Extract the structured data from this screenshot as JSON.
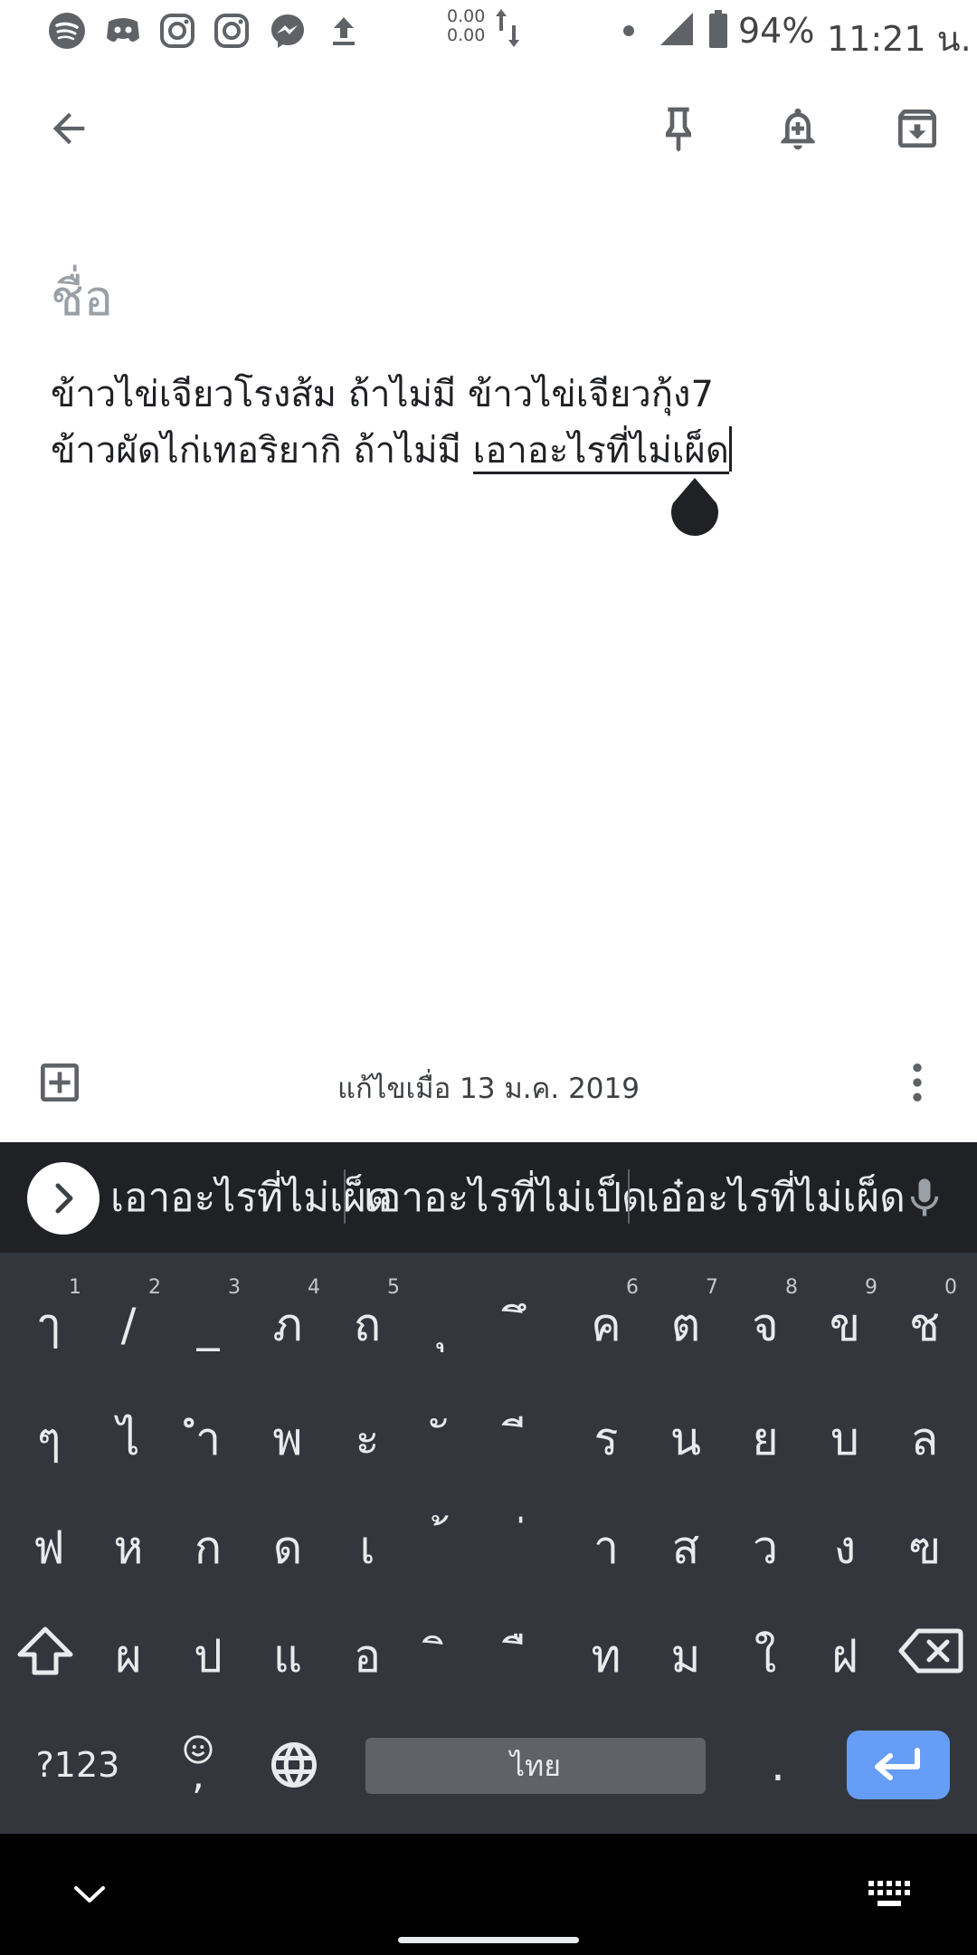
{
  "status_bar": {
    "apps": [
      "spotify-icon",
      "discord-icon",
      "instagram-icon",
      "instagram-icon",
      "messenger-icon",
      "upload-icon"
    ],
    "net_up": "0.00",
    "net_down": "0.00",
    "battery": "94%",
    "time": "11:21 น."
  },
  "toolbar": {
    "back_icon": "arrow-back-icon",
    "pin_icon": "pin-icon",
    "reminder_icon": "bell-plus-icon",
    "archive_icon": "archive-icon"
  },
  "note": {
    "title_placeholder": "ชื่อ",
    "line1": "ข้าวไข่เจียวโรงส้ม ถ้าไม่มี ข้าวไข่เจียวกุ้ง7",
    "line2_prefix": "ข้าวผัดไก่เทอริยากิ ถ้าไม่มี ",
    "line2_composing": "เอาอะไรที่ไม่เผ็ด"
  },
  "bottom_bar": {
    "edited": "แก้ไขเมื่อ 13 ม.ค. 2019"
  },
  "keyboard": {
    "suggestions": [
      "เอาอะไรที่ไม่เผ็ด",
      "เอาอะไรที่ไม่เป็ด",
      "เอ๋อะไรที่ไม่เผ็ด"
    ],
    "rows": [
      [
        {
          "k": "ๅ",
          "h": "1"
        },
        {
          "k": "/",
          "h": "2"
        },
        {
          "k": "_",
          "h": "3"
        },
        {
          "k": "ภ",
          "h": "4"
        },
        {
          "k": "ถ",
          "h": "5"
        },
        {
          "k": "ุ",
          "h": ""
        },
        {
          "k": "ึ",
          "h": ""
        },
        {
          "k": "ค",
          "h": "6"
        },
        {
          "k": "ต",
          "h": "7"
        },
        {
          "k": "จ",
          "h": "8"
        },
        {
          "k": "ข",
          "h": "9"
        },
        {
          "k": "ช",
          "h": "0"
        }
      ],
      [
        {
          "k": "ๆ",
          "h": ""
        },
        {
          "k": "ไ",
          "h": ""
        },
        {
          "k": "ำ",
          "h": ""
        },
        {
          "k": "พ",
          "h": ""
        },
        {
          "k": "ะ",
          "h": ""
        },
        {
          "k": "ั",
          "h": ""
        },
        {
          "k": "ี",
          "h": ""
        },
        {
          "k": "ร",
          "h": ""
        },
        {
          "k": "น",
          "h": ""
        },
        {
          "k": "ย",
          "h": ""
        },
        {
          "k": "บ",
          "h": ""
        },
        {
          "k": "ล",
          "h": ""
        }
      ],
      [
        {
          "k": "ฟ",
          "h": ""
        },
        {
          "k": "ห",
          "h": ""
        },
        {
          "k": "ก",
          "h": ""
        },
        {
          "k": "ด",
          "h": ""
        },
        {
          "k": "เ",
          "h": ""
        },
        {
          "k": "้",
          "h": ""
        },
        {
          "k": "่",
          "h": ""
        },
        {
          "k": "า",
          "h": ""
        },
        {
          "k": "ส",
          "h": ""
        },
        {
          "k": "ว",
          "h": ""
        },
        {
          "k": "ง",
          "h": ""
        },
        {
          "k": "ฃ",
          "h": ""
        }
      ],
      [
        {
          "k": "ผ",
          "h": ""
        },
        {
          "k": "ป",
          "h": ""
        },
        {
          "k": "แ",
          "h": ""
        },
        {
          "k": "อ",
          "h": ""
        },
        {
          "k": "ิ",
          "h": ""
        },
        {
          "k": "ื",
          "h": ""
        },
        {
          "k": "ท",
          "h": ""
        },
        {
          "k": "ม",
          "h": ""
        },
        {
          "k": "ใ",
          "h": ""
        },
        {
          "k": "ฝ",
          "h": ""
        }
      ]
    ],
    "symbols_label": "?123",
    "emoji_comma": ",",
    "space_label": "ไทย",
    "period_label": "."
  },
  "nav_bar": {
    "hide_keyboard_icon": "chevron-down-icon",
    "keyboard_switch_icon": "keyboard-icon"
  }
}
